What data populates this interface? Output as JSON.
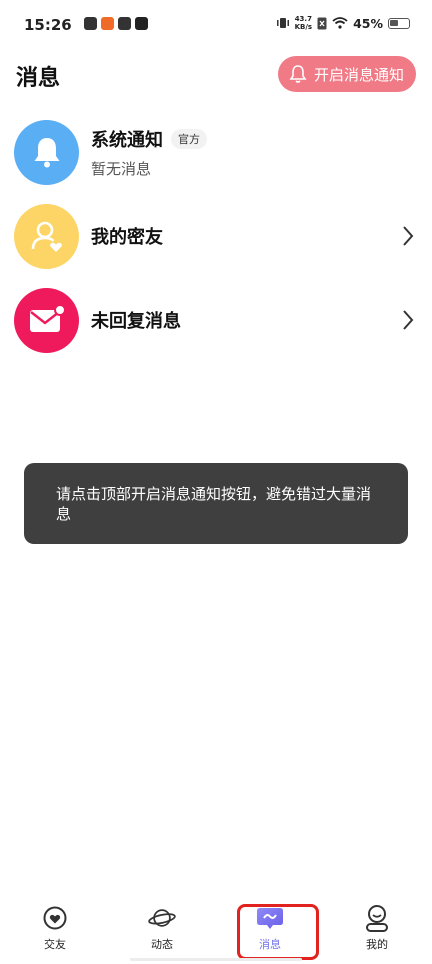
{
  "status_bar": {
    "time": "15:26",
    "net_speed_top": "43.7",
    "net_speed_bottom": "KB/s",
    "battery_percent": "45%"
  },
  "header": {
    "title": "消息",
    "notify_button_label": "开启消息通知"
  },
  "rows": [
    {
      "title": "系统通知",
      "badge": "官方",
      "subtitle": "暂无消息",
      "icon": "bell-icon",
      "color": "#5aaef4"
    },
    {
      "title": "我的密友",
      "icon": "friend-heart-icon",
      "color": "#fdd566"
    },
    {
      "title": "未回复消息",
      "icon": "envelope-icon",
      "color": "#ef1a5c"
    }
  ],
  "toast": {
    "text": "请点击顶部开启消息通知按钮，避免错过大量消息"
  },
  "tabbar": {
    "tabs": [
      {
        "label": "交友",
        "icon": "heart-circle-icon"
      },
      {
        "label": "动态",
        "icon": "planet-icon"
      },
      {
        "label": "消息",
        "icon": "message-bubble-icon",
        "active": true
      },
      {
        "label": "我的",
        "icon": "profile-icon"
      }
    ]
  },
  "colors": {
    "notify_button": "#f07a86",
    "active_tab": "#6f72ec",
    "highlight_box": "#e1221f",
    "toast_bg": "#3f3f3f"
  }
}
